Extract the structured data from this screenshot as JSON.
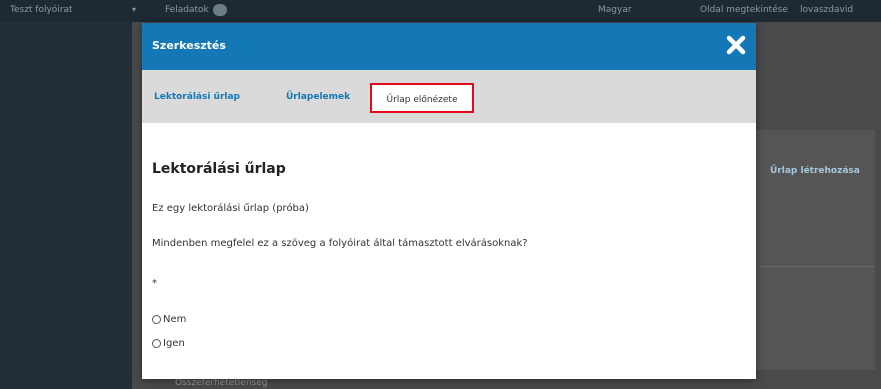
{
  "background": {
    "journal_name": "Teszt folyóirat",
    "tasks_label": "Feladatok",
    "right_link_1": "Magyar",
    "right_link_2": "Oldal megtekintése",
    "right_link_3": "lovaszdavid",
    "create_form_link": "Űrlap létrehozása",
    "bottom_partial_text": "Összeférhetetlenség"
  },
  "modal": {
    "title": "Szerkesztés",
    "tabs": [
      {
        "label": "Lektorálási űrlap"
      },
      {
        "label": "Űrlapelemek"
      },
      {
        "label": "Űrlap előnézete"
      }
    ],
    "form": {
      "title": "Lektorálási űrlap",
      "description": "Ez egy lektorálási űrlap (próba)",
      "question": "Mindenben megfelel ez a szöveg a folyóirat által támasztott elvárásoknak?",
      "required_marker": "*",
      "options": [
        {
          "label": "Nem"
        },
        {
          "label": "Igen"
        }
      ]
    }
  },
  "colors": {
    "header_blue": "#1378b5",
    "highlight_red": "#e00b1a",
    "tab_bar": "#dadada"
  }
}
